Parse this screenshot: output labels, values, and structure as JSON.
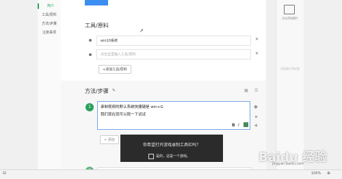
{
  "nav": {
    "items": [
      "简介",
      "工具/原料",
      "方法/步骤",
      "注意事项"
    ]
  },
  "tools": {
    "title": "工具/原料",
    "item1_value": "win10系统",
    "item2_placeholder": "点击这里输入工具/原料",
    "add_label": "+添加工具/原料"
  },
  "steps": {
    "title": "方法/步骤",
    "step_number": "1",
    "line1": "录制视频的默认系统快捷键是 win+G",
    "line2": "我们现在就可以按一下试试",
    "add_label": "+ 添加",
    "step2_number": "2"
  },
  "right": {
    "cover_label": "点击添加图片",
    "side_text": "添加图片到封面"
  },
  "toast": {
    "message": "你希望打开游戏录制工具栏吗？",
    "checkbox_label": "是的，这是一个游戏。"
  },
  "status": {
    "zoom": "100%"
  },
  "watermark": {
    "text": "Baidu 经验",
    "sub": "jingyan.baidu.com"
  },
  "colors": {
    "accent_green": "#2aa15b",
    "accent_blue": "#3d8ef0"
  }
}
